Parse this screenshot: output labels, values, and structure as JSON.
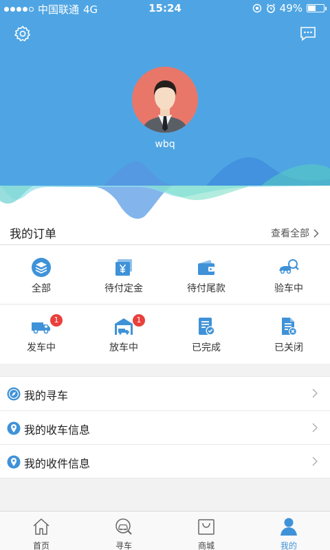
{
  "status_bar": {
    "carrier": "中国联通",
    "network": "4G",
    "time": "15:24",
    "battery": "49%",
    "battery_level": 0.49
  },
  "profile": {
    "username": "wbq"
  },
  "orders": {
    "title": "我的订单",
    "view_all": "查看全部",
    "items": [
      {
        "label": "全部",
        "icon": "layers-icon"
      },
      {
        "label": "待付定金",
        "icon": "yuan-card-icon"
      },
      {
        "label": "待付尾款",
        "icon": "wallet-icon"
      },
      {
        "label": "验车中",
        "icon": "car-inspect-icon"
      },
      {
        "label": "发车中",
        "icon": "truck-icon",
        "badge": "1"
      },
      {
        "label": "放车中",
        "icon": "garage-icon",
        "badge": "1"
      },
      {
        "label": "已完成",
        "icon": "doc-check-icon"
      },
      {
        "label": "已关闭",
        "icon": "doc-close-icon"
      }
    ]
  },
  "menu": [
    {
      "label": "我的寻车",
      "icon": "compass-icon"
    },
    {
      "label": "我的收车信息",
      "icon": "location-pin-icon"
    },
    {
      "label": "我的收件信息",
      "icon": "location-pin-icon"
    }
  ],
  "tabbar": [
    {
      "label": "首页",
      "icon": "home-icon"
    },
    {
      "label": "寻车",
      "icon": "car-search-icon"
    },
    {
      "label": "商城",
      "icon": "shopping-bag-icon"
    },
    {
      "label": "我的",
      "icon": "user-icon",
      "active": true
    }
  ],
  "colors": {
    "header_blue": "#4fa5e3",
    "accent": "#3f92d8",
    "badge_red": "#e9403c",
    "avatar_bg": "#e8776a"
  }
}
